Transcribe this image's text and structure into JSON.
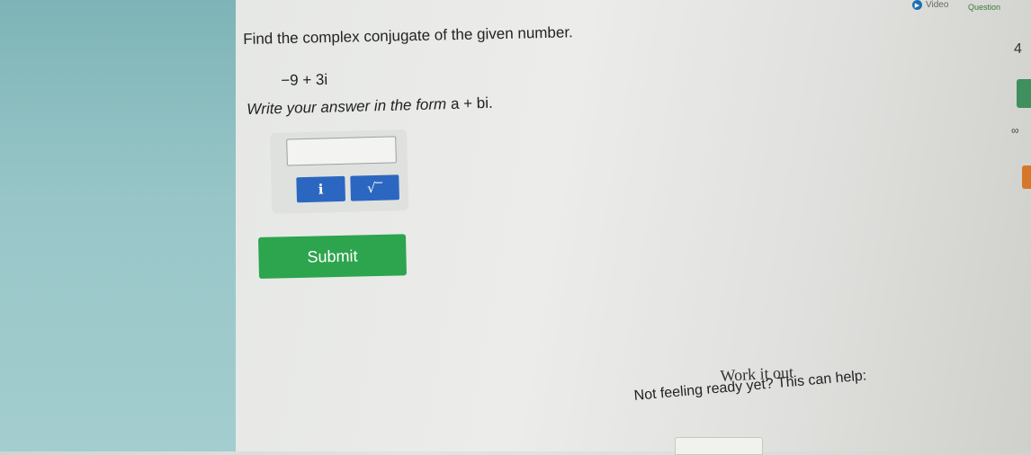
{
  "question": {
    "text": "Find the complex conjugate of the given number.",
    "expression": "−9 + 3i",
    "instruction_lead": "Write your answer in the form",
    "instruction_form": "a + bi."
  },
  "answer": {
    "value": "",
    "placeholder": ""
  },
  "toolbar": {
    "i_label": "i",
    "sqrt_label": "√‾"
  },
  "submit_label": "Submit",
  "work_it_out": {
    "title": "Work it out",
    "help_text": "Not feeling ready yet? This can help:"
  },
  "header": {
    "video_label": "Video",
    "questions_label": "Question"
  },
  "sidebar": {
    "count": "4",
    "infinity": "∞"
  },
  "colors": {
    "accent_blue": "#2b67c1",
    "submit_green": "#2da44e",
    "left_strip": "#98c6c8"
  }
}
